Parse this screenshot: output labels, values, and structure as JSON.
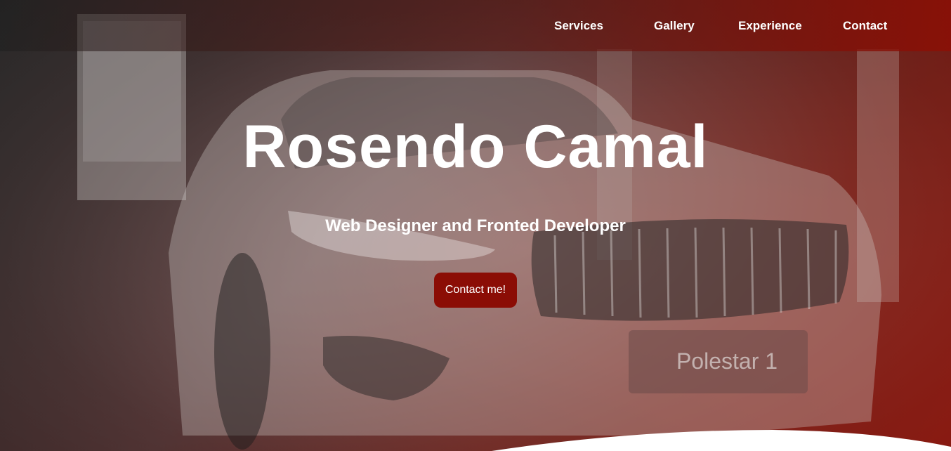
{
  "nav": {
    "items": [
      {
        "label": "Services"
      },
      {
        "label": "Gallery"
      },
      {
        "label": "Experience"
      },
      {
        "label": "Contact"
      }
    ]
  },
  "hero": {
    "title": "Rosendo Camal",
    "subtitle": "Web Designer and Fronted Developer",
    "cta_label": "Contact me!",
    "license_plate": "Polestar 1"
  },
  "colors": {
    "accent": "#8b0d05",
    "nav_gradient_end": "#8c0f05",
    "text": "#ffffff"
  }
}
